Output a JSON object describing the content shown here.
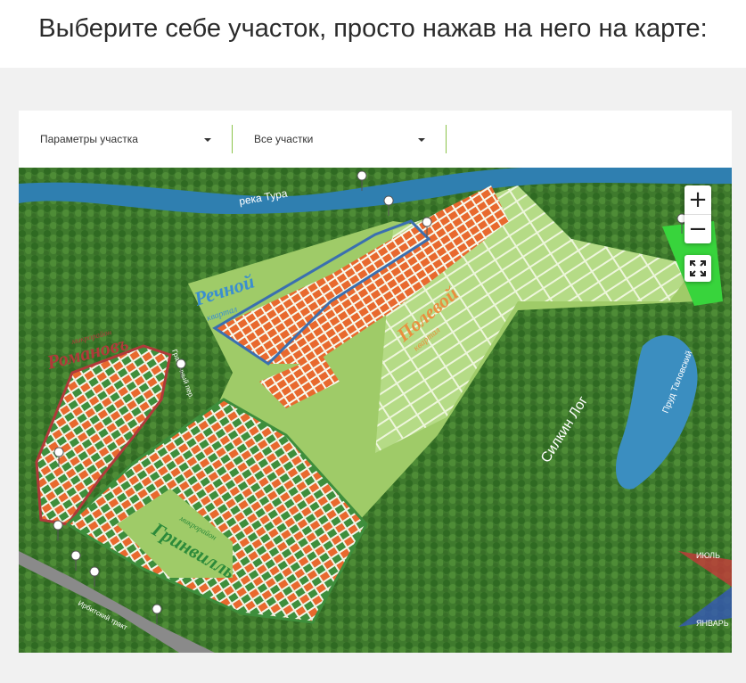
{
  "header": {
    "title": "Выберите себе участок, просто нажав на него на карте:"
  },
  "filters": {
    "params_label": "Параметры участка",
    "plots_label": "Все участки"
  },
  "map": {
    "labels": {
      "river": "река Тура",
      "rechnoy": "Речной",
      "rechnoy_sub": "квартал",
      "polevoy": "Полевой",
      "polevoy_sub": "квартал",
      "romanov": "Романовъ",
      "romanov_sub": "микрорайон",
      "grinvilly": "Гринвилль",
      "grinvilly_sub": "микрорайон",
      "silkin_log": "Силкин Лог",
      "pond": "Пруд Таловский",
      "road": "Ирбитский тракт",
      "lane": "Граничный пер."
    },
    "zoom_in": "+",
    "zoom_out": "−",
    "compass": {
      "top": "ИЮЛЬ",
      "bottom": "ЯНВАРЬ"
    },
    "colors": {
      "available": "#e8692e",
      "sold": "#3e8e3c",
      "reserved": "#d9e04a",
      "quarter_border": "#3a6fb0",
      "micro_border": "#b03a3a"
    }
  }
}
